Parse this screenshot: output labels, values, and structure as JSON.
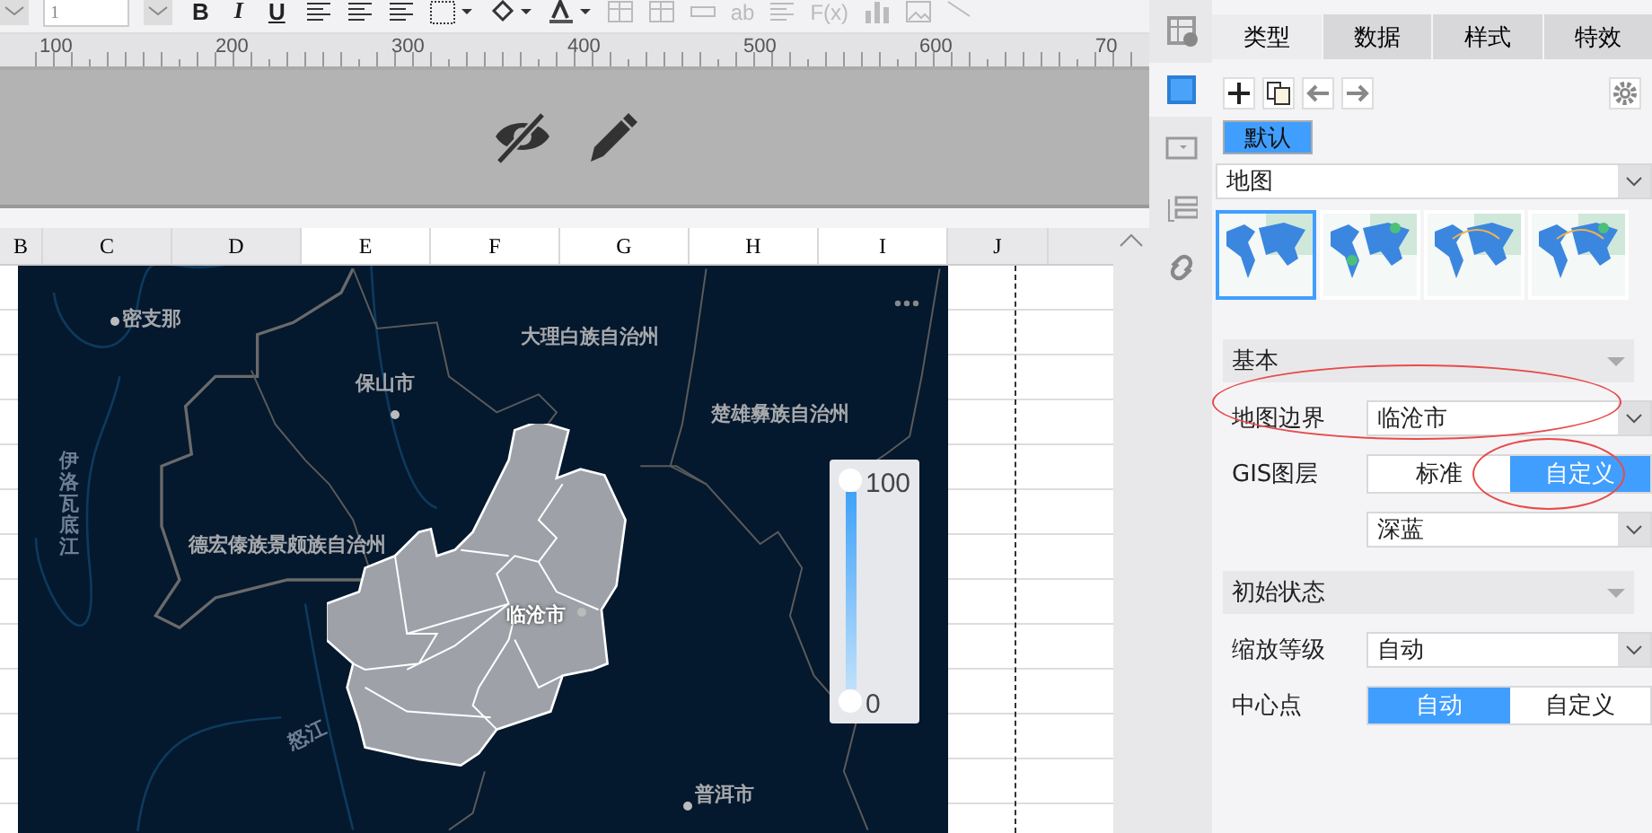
{
  "toolbar": {
    "font_size": "1",
    "format_buttons": [
      {
        "label": "B",
        "kind": "bold"
      },
      {
        "label": "I",
        "kind": "italic"
      },
      {
        "label": "U",
        "kind": "underline"
      }
    ],
    "disabled_texts": [
      "ab",
      "F(x)"
    ]
  },
  "ruler": {
    "ticks": [
      "100",
      "200",
      "300",
      "400",
      "500",
      "600",
      "70"
    ]
  },
  "columns": [
    {
      "label": "B",
      "selected": false
    },
    {
      "label": "C",
      "selected": false
    },
    {
      "label": "D",
      "selected": false
    },
    {
      "label": "E",
      "selected": true
    },
    {
      "label": "F",
      "selected": true
    },
    {
      "label": "G",
      "selected": true
    },
    {
      "label": "H",
      "selected": true
    },
    {
      "label": "I",
      "selected": true
    },
    {
      "label": "J",
      "selected": false
    }
  ],
  "map": {
    "labels": [
      {
        "text": "密支那",
        "kind": "city"
      },
      {
        "text": "保山市",
        "kind": "city"
      },
      {
        "text": "大理白族自治州",
        "kind": "region"
      },
      {
        "text": "楚雄彝族自治州",
        "kind": "region"
      },
      {
        "text": "伊洛瓦底江",
        "kind": "river"
      },
      {
        "text": "德宏傣族景颇族自治州",
        "kind": "region"
      },
      {
        "text": "临沧市",
        "kind": "city"
      },
      {
        "text": "怒江",
        "kind": "river"
      },
      {
        "text": "普洱市",
        "kind": "city"
      }
    ],
    "legend": {
      "max": "100",
      "min": "0",
      "level": 1
    }
  },
  "side_icons": [
    {
      "selected": false
    },
    {
      "selected": true
    },
    {
      "selected": false
    },
    {
      "selected": false
    },
    {
      "selected": false
    }
  ],
  "panel": {
    "tabs": [
      {
        "label": "类型",
        "selected": true
      },
      {
        "label": "数据",
        "selected": false
      },
      {
        "label": "样式",
        "selected": false
      },
      {
        "label": "特效",
        "selected": false
      }
    ],
    "default_button": "默认",
    "chart_type": "地图",
    "thumbnails": [
      {
        "selected": true
      },
      {
        "selected": false
      },
      {
        "selected": false
      },
      {
        "selected": false
      }
    ],
    "sections": [
      {
        "title": "基本",
        "rows": [
          {
            "kind": "select",
            "label": "地图边界",
            "value": "临沧市"
          },
          {
            "kind": "segmented",
            "label": "GIS图层",
            "options": [
              {
                "label": "标准",
                "selected": false
              },
              {
                "label": "自定义",
                "selected": true
              }
            ]
          },
          {
            "kind": "select",
            "label": "",
            "value": "深蓝"
          }
        ]
      },
      {
        "title": "初始状态",
        "rows": [
          {
            "kind": "select",
            "label": "缩放等级",
            "value": "自动"
          },
          {
            "kind": "segmented",
            "label": "中心点",
            "options": [
              {
                "label": "自动",
                "selected": true
              },
              {
                "label": "自定义",
                "selected": false
              }
            ]
          }
        ]
      }
    ]
  }
}
